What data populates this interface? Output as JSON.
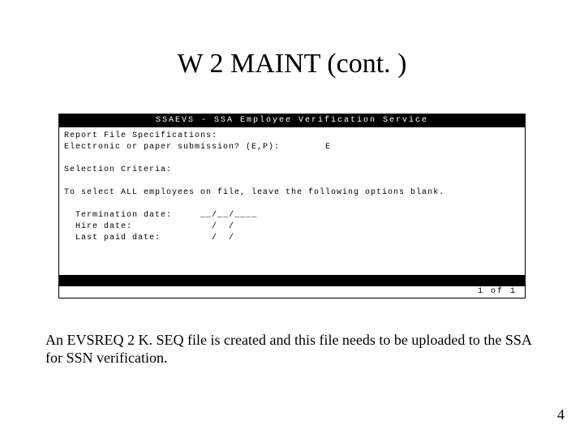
{
  "title": "W 2 MAINT (cont. )",
  "terminal": {
    "header": "SSAEVS - SSA Employee Verification Service",
    "spec_heading": "Report File Specifications:",
    "submission_prompt": "Electronic or paper submission? (E,P):",
    "submission_value": "E",
    "selection_heading": "Selection Criteria:",
    "select_all_text": "To select ALL employees on file, leave the following options blank.",
    "fields": {
      "termination": {
        "label": "Termination date:",
        "value": "__/__/____"
      },
      "hire": {
        "label": "Hire date:",
        "value": "  /  /"
      },
      "last_paid": {
        "label": "Last paid date:",
        "value": "  /  /"
      }
    },
    "footer_page": "1 of   1"
  },
  "caption": "An EVSREQ 2 K. SEQ file is created and this file needs to be uploaded to the SSA for SSN verification.",
  "page_number": "4"
}
